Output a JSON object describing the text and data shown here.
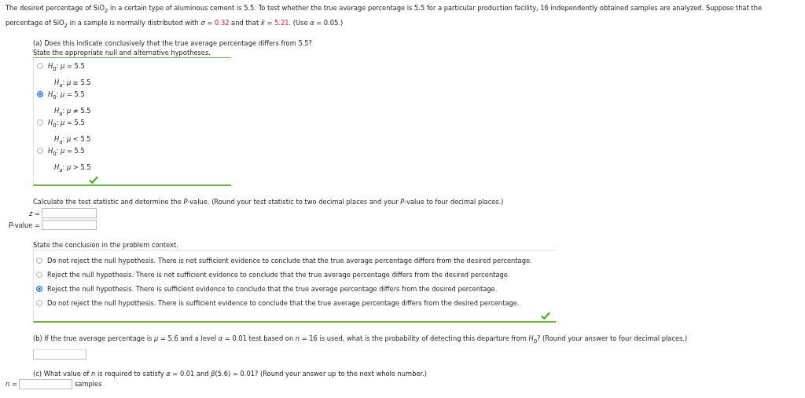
{
  "intro": [
    {
      "kind": "text",
      "text": "The desired percentage of SiO$_{2}$ in a certain type of aluminous cement is 5.5. To test whether the true average percentage is 5.5 for a particular production facility, 16 independently obtained samples are analyzed. Suppose that the percentage of SiO$_{2}$ in a sample is normally distributed with *σ* = "
    },
    {
      "kind": "given",
      "text": "0.32"
    },
    {
      "kind": "text",
      "text": " and that *x̄* = "
    },
    {
      "kind": "given",
      "text": "5.21"
    },
    {
      "kind": "text",
      "text": ". (Use *α* = 0.05.)"
    }
  ],
  "part_a": {
    "question": "(a) Does this indicate conclusively that the true average percentage differs from 5.5?",
    "instruction": "State the appropriate null and alternative hypotheses.",
    "correct": true,
    "hypotheses": [
      {
        "h0": "*H*$_{0}$: *μ* = 5.5",
        "ha": "*H*$_{a}$: *μ* ≥ 5.5",
        "selected": false
      },
      {
        "h0": "*H*$_{0}$: *μ* = 5.5",
        "ha": "*H*$_{a}$: *μ* ≠ 5.5",
        "selected": true
      },
      {
        "h0": "*H*$_{0}$: *μ* = 5.5",
        "ha": "*H*$_{a}$: *μ* < 5.5",
        "selected": false
      },
      {
        "h0": "*H*$_{0}$: *μ* = 5.5",
        "ha": "*H*$_{a}$: *μ* > 5.5",
        "selected": false
      }
    ]
  },
  "calculation": {
    "prompt": "Calculate the test statistic and determine the *P*-value. (Round your test statistic to two decimal places and your *P*-value to four decimal places.)",
    "fields": [
      {
        "label": "*z* ="
      },
      {
        "label": "*P*-value ="
      }
    ]
  },
  "conclusion": {
    "prompt": "State the conclusion in the problem context.",
    "correct": true,
    "options": [
      {
        "text": "Do not reject the null hypothesis. There is not sufficient evidence to conclude that the true average percentage differs from the desired percentage.",
        "selected": false
      },
      {
        "text": "Reject the null hypothesis. There is not sufficient evidence to conclude that the true average percentage differs from the desired percentage.",
        "selected": false
      },
      {
        "text": "Reject the null hypothesis. There is sufficient evidence to conclude that the true average percentage differs from the desired percentage.",
        "selected": true
      },
      {
        "text": "Do not reject the null hypothesis. There is sufficient evidence to conclude that the true average percentage differs from the desired percentage.",
        "selected": false
      }
    ]
  },
  "part_b": {
    "question": "(b) If the true average percentage is *μ* = 5.6 and a level *α* = 0.01 test based on *n* = 16 is used, what is the probability of detecting this departure from *H*$_{0}$? (Round your answer to four decimal places.)"
  },
  "part_c": {
    "question": "(c) What value of *n* is required to satisfy *α* = 0.01 and *β*(5.6) = 0.01? (Round your answer up to the next whole number.)",
    "label": "*n* =",
    "unit": "samples"
  }
}
